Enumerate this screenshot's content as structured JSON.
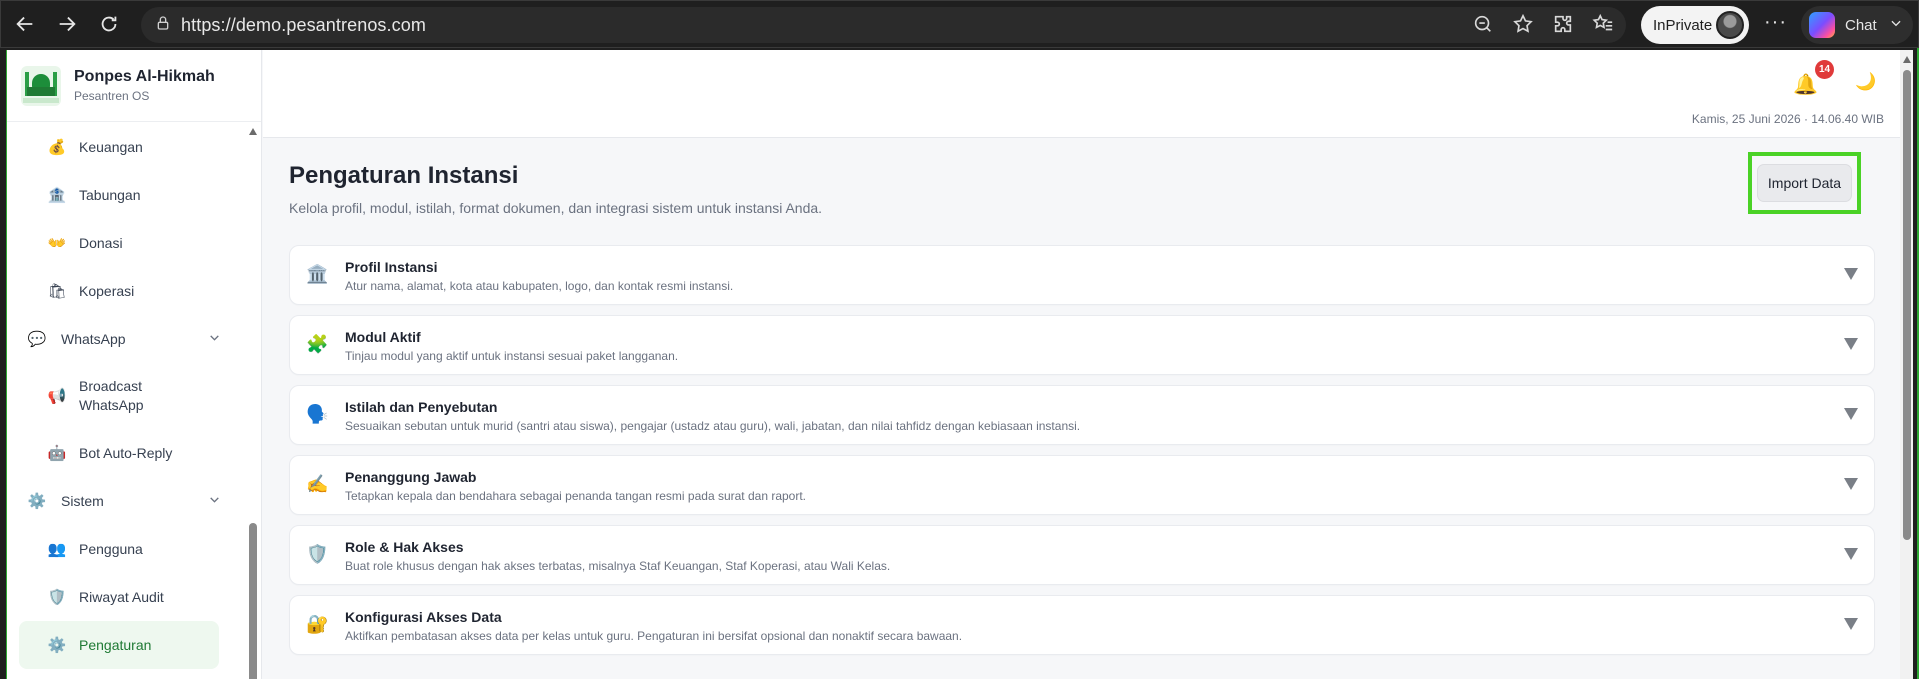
{
  "browser": {
    "url": "https://demo.pesantrenos.com",
    "inprivate_label": "InPrivate",
    "chat_label": "Chat",
    "more_label": "···"
  },
  "brand": {
    "name": "Ponpes Al-Hikmah",
    "subtitle": "Pesantren OS"
  },
  "sidebar": {
    "items": [
      {
        "label": "Keuangan",
        "icon": "money-bag-icon",
        "glyph": "💰"
      },
      {
        "label": "Tabungan",
        "icon": "bank-icon",
        "glyph": "🏦"
      },
      {
        "label": "Donasi",
        "icon": "open-hands-icon",
        "glyph": "👐"
      },
      {
        "label": "Koperasi",
        "icon": "shopping-bags-icon",
        "glyph": "🛍"
      }
    ],
    "whatsapp_group": {
      "label": "WhatsApp",
      "icon": "speech-bubble-icon",
      "glyph": "💬"
    },
    "whatsapp_items": [
      {
        "label": "Broadcast WhatsApp",
        "icon": "megaphone-icon",
        "glyph": "📢"
      },
      {
        "label": "Bot Auto-Reply",
        "icon": "robot-icon",
        "glyph": "🤖"
      }
    ],
    "sistem_group": {
      "label": "Sistem",
      "icon": "gear-icon",
      "glyph": "⚙️"
    },
    "sistem_items": [
      {
        "label": "Pengguna",
        "icon": "users-icon",
        "glyph": "👥"
      },
      {
        "label": "Riwayat Audit",
        "icon": "shield-icon",
        "glyph": "🛡️"
      },
      {
        "label": "Pengaturan",
        "icon": "gear-icon",
        "glyph": "⚙️"
      }
    ]
  },
  "topbar": {
    "notification_count": "14",
    "datetime": "Kamis, 25 Juni 2026 · 14.06.40 WIB"
  },
  "page": {
    "title": "Pengaturan Instansi",
    "description": "Kelola profil, modul, istilah, format dokumen, dan integrasi sistem untuk instansi Anda.",
    "import_label": "Import Data"
  },
  "sections": [
    {
      "title": "Profil Instansi",
      "desc": "Atur nama, alamat, kota atau kabupaten, logo, dan kontak resmi instansi.",
      "icon": "institution-icon",
      "glyph": "🏛️"
    },
    {
      "title": "Modul Aktif",
      "desc": "Tinjau modul yang aktif untuk instansi sesuai paket langganan.",
      "icon": "puzzle-icon",
      "glyph": "🧩"
    },
    {
      "title": "Istilah dan Penyebutan",
      "desc": "Sesuaikan sebutan untuk murid (santri atau siswa), pengajar (ustadz atau guru), wali, jabatan, dan nilai tahfidz dengan kebiasaan instansi.",
      "icon": "speaking-head-icon",
      "glyph": "🗣️"
    },
    {
      "title": "Penanggung Jawab",
      "desc": "Tetapkan kepala dan bendahara sebagai penanda tangan resmi pada surat dan raport.",
      "icon": "writing-hand-icon",
      "glyph": "✍️"
    },
    {
      "title": "Role & Hak Akses",
      "desc": "Buat role khusus dengan hak akses terbatas, misalnya Staf Keuangan, Staf Koperasi, atau Wali Kelas.",
      "icon": "shield-icon",
      "glyph": "🛡️"
    },
    {
      "title": "Konfigurasi Akses Data",
      "desc": "Aktifkan pembatasan akses data per kelas untuk guru. Pengaturan ini bersifat opsional dan nonaktif secara bawaan.",
      "icon": "lock-icon",
      "glyph": "🔐"
    }
  ],
  "colors": {
    "accent": "#1f7a34",
    "highlight": "#4ad226",
    "badge": "#e03a3a"
  }
}
